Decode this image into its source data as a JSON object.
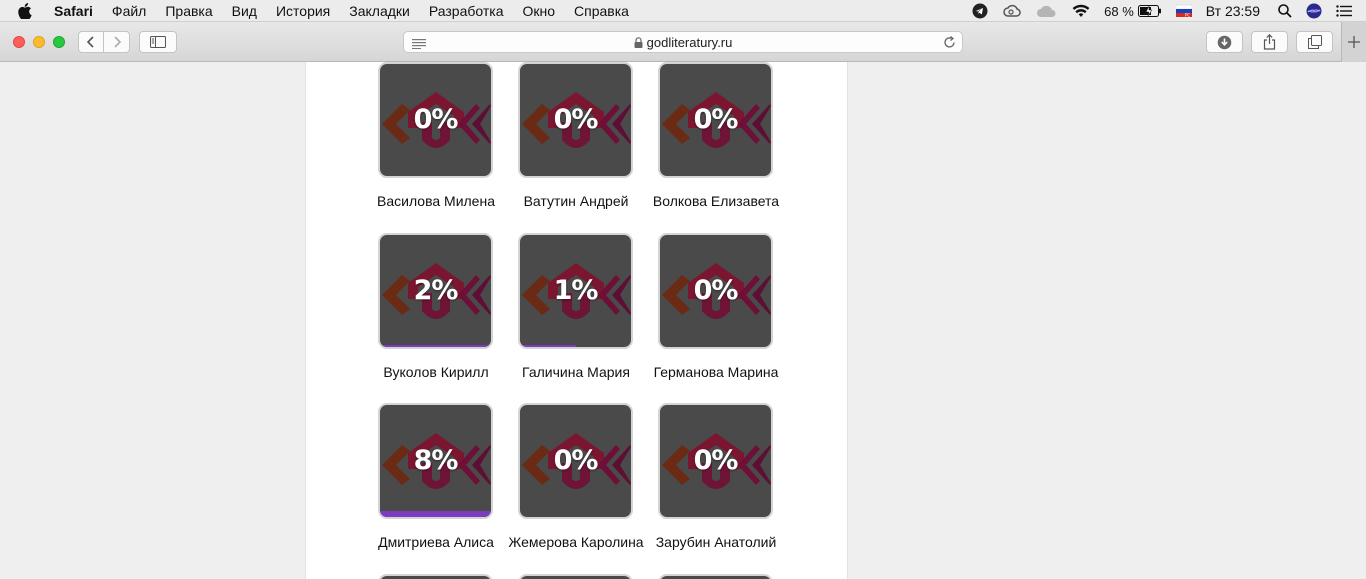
{
  "menubar": {
    "app": "Safari",
    "items": [
      "Файл",
      "Правка",
      "Вид",
      "История",
      "Закладки",
      "Разработка",
      "Окно",
      "Справка"
    ],
    "battery": "68 %",
    "clock": "Вт 23:59"
  },
  "browser": {
    "url": "godliteratury.ru"
  },
  "colors": {
    "progress": "#7d3bbd",
    "tile_bg": "#4a4a4a"
  },
  "cards": [
    {
      "percent": "0%",
      "progress": 0,
      "name": "Василова Милена"
    },
    {
      "percent": "0%",
      "progress": 0,
      "name": "Ватутин Андрей"
    },
    {
      "percent": "0%",
      "progress": 0,
      "name": "Волкова Елизавета"
    },
    {
      "percent": "2%",
      "progress": 0.02,
      "name": "Вуколов Кирилл"
    },
    {
      "percent": "1%",
      "progress": 0.01,
      "name": "Галичина Мария"
    },
    {
      "percent": "0%",
      "progress": 0,
      "name": "Германова Марина"
    },
    {
      "percent": "8%",
      "progress": 0.08,
      "name": "Дмитриева Алиса"
    },
    {
      "percent": "0%",
      "progress": 0,
      "name": "Жемерова Каролина"
    },
    {
      "percent": "0%",
      "progress": 0,
      "name": "Зарубин Анатолий"
    }
  ]
}
